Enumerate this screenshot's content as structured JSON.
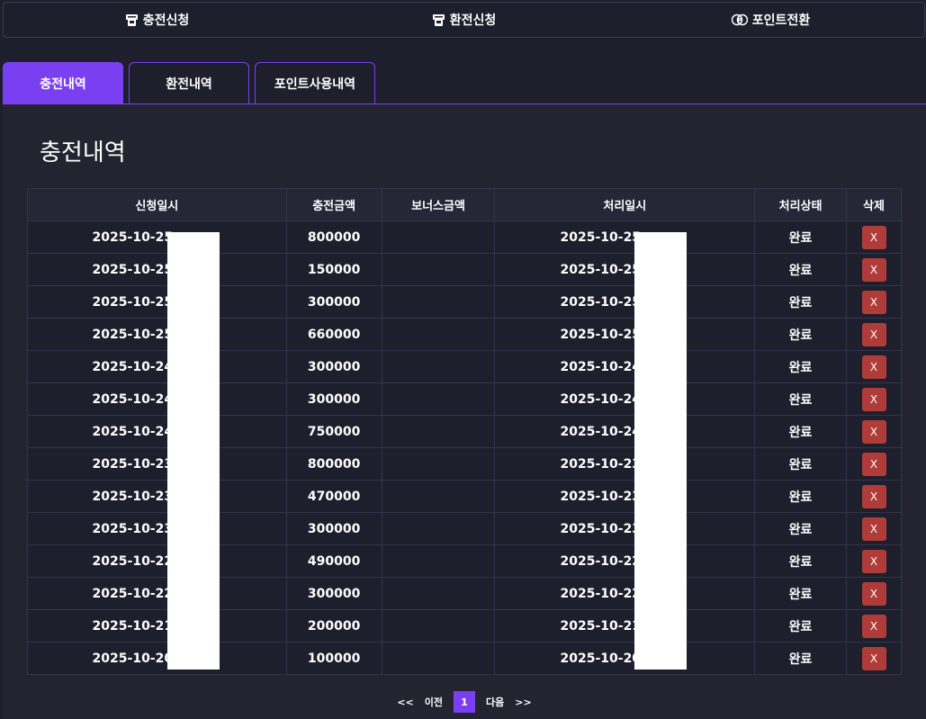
{
  "topnav": {
    "charge": "충전신청",
    "exchange": "환전신청",
    "point": "포인트전환"
  },
  "tabs": [
    "충전내역",
    "환전내역",
    "포인트사용내역"
  ],
  "page_title": "충전내역",
  "table": {
    "headers": [
      "신청일시",
      "충전금액",
      "보너스금액",
      "처리일시",
      "처리상태",
      "삭제"
    ],
    "rows": [
      {
        "req": "2025-10-25",
        "amount": "800000",
        "bonus": "",
        "proc": "2025-10-25",
        "status": "완료",
        "del": "X"
      },
      {
        "req": "2025-10-25",
        "amount": "150000",
        "bonus": "",
        "proc": "2025-10-25",
        "status": "완료",
        "del": "X"
      },
      {
        "req": "2025-10-25",
        "amount": "300000",
        "bonus": "",
        "proc": "2025-10-25",
        "status": "완료",
        "del": "X"
      },
      {
        "req": "2025-10-25",
        "amount": "660000",
        "bonus": "",
        "proc": "2025-10-25",
        "status": "완료",
        "del": "X"
      },
      {
        "req": "2025-10-24",
        "amount": "300000",
        "bonus": "",
        "proc": "2025-10-24",
        "status": "완료",
        "del": "X"
      },
      {
        "req": "2025-10-24",
        "amount": "300000",
        "bonus": "",
        "proc": "2025-10-24",
        "status": "완료",
        "del": "X"
      },
      {
        "req": "2025-10-24",
        "amount": "750000",
        "bonus": "",
        "proc": "2025-10-24",
        "status": "완료",
        "del": "X"
      },
      {
        "req": "2025-10-23",
        "amount": "800000",
        "bonus": "",
        "proc": "2025-10-23",
        "status": "완료",
        "del": "X"
      },
      {
        "req": "2025-10-23",
        "amount": "470000",
        "bonus": "",
        "proc": "2025-10-23",
        "status": "완료",
        "del": "X"
      },
      {
        "req": "2025-10-23",
        "amount": "300000",
        "bonus": "",
        "proc": "2025-10-23",
        "status": "완료",
        "del": "X"
      },
      {
        "req": "2025-10-22",
        "amount": "490000",
        "bonus": "",
        "proc": "2025-10-22",
        "status": "완료",
        "del": "X"
      },
      {
        "req": "2025-10-22",
        "amount": "300000",
        "bonus": "",
        "proc": "2025-10-22",
        "status": "완료",
        "del": "X"
      },
      {
        "req": "2025-10-21",
        "amount": "200000",
        "bonus": "",
        "proc": "2025-10-21",
        "status": "완료",
        "del": "X"
      },
      {
        "req": "2025-10-20",
        "amount": "100000",
        "bonus": "",
        "proc": "2025-10-20",
        "status": "완료",
        "del": "X"
      }
    ]
  },
  "pager": {
    "first": "<<",
    "prev": "이전",
    "current": "1",
    "next": "다음",
    "last": ">>"
  },
  "colors": {
    "accent": "#7b3ff2",
    "delete": "#b03c3a",
    "background": "#1e1f2c"
  },
  "icons": {
    "charge": "atm-icon",
    "exchange": "atm-icon",
    "point": "point-coin-icon"
  }
}
